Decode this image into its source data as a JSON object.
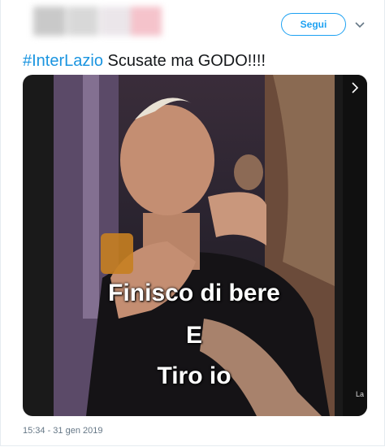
{
  "header": {
    "follow_label": "Segui"
  },
  "tweet": {
    "hashtag": "#InterLazio",
    "text": " Scusate ma GODO!!!!",
    "timestamp": "15:34 - 31 gen 2019"
  },
  "media": {
    "overlay_lines": [
      "Finisco di bere",
      "E",
      "Tiro io"
    ],
    "next_label": "La"
  },
  "colors": {
    "accent": "#1da1f2",
    "hashtag": "#1b95e0",
    "muted": "#657786"
  }
}
